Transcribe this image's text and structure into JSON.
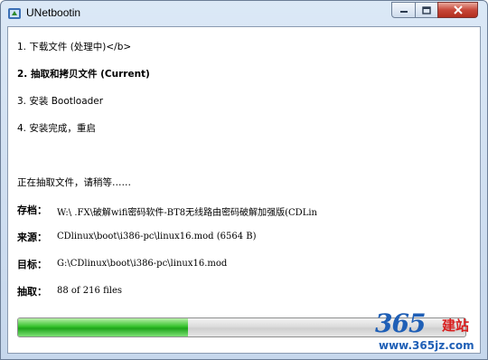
{
  "window": {
    "title": "UNetbootin"
  },
  "steps": [
    {
      "text": "1. 下载文件 (处理中)</b>"
    },
    {
      "text": "2. 抽取和拷贝文件 (Current)"
    },
    {
      "text": "3. 安装 Bootloader"
    },
    {
      "text": "4. 安装完成，重启"
    }
  ],
  "status_text": "正在抽取文件，请稍等……",
  "details": {
    "archive": {
      "label": "存档：",
      "value": "W:\\                    .FX\\破解wifi密码软件-BT8无线路由密码破解加强版(CDLin"
    },
    "source": {
      "label": "来源：",
      "value": "CDlinux\\boot\\i386-pc\\linux16.mod (6564 B)"
    },
    "target": {
      "label": "目标：",
      "value": "G:\\CDlinux\\boot\\i386-pc\\linux16.mod"
    },
    "extracted": {
      "label": "抽取：",
      "value": "88 of 216 files"
    }
  },
  "progress": {
    "fraction": 0.38,
    "color": "#22b51e"
  },
  "watermark": {
    "number": "365",
    "brand": "建站",
    "url": "www.365jz.com"
  },
  "icons": {
    "app": "unetbootin-icon",
    "minimize": "minimize-icon",
    "maximize": "maximize-icon",
    "close": "close-icon"
  }
}
